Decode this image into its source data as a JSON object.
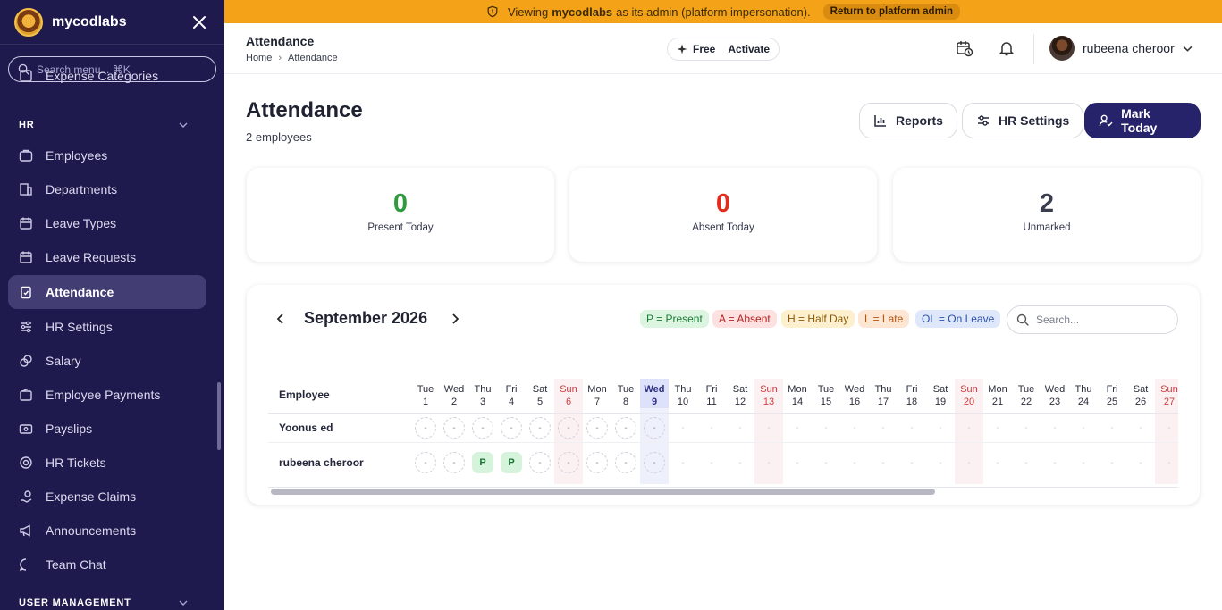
{
  "sidebar": {
    "brand": "mycodlabs",
    "search_placeholder": "Search menu... ⌘K",
    "partial_item": "Expense Categories",
    "hr_section": "HR",
    "items": [
      {
        "label": "Employees",
        "icon": "employees-icon"
      },
      {
        "label": "Departments",
        "icon": "building-icon"
      },
      {
        "label": "Leave Types",
        "icon": "calendar-icon"
      },
      {
        "label": "Leave Requests",
        "icon": "calendar-check-icon"
      },
      {
        "label": "Attendance",
        "icon": "clipboard-check-icon",
        "active": true
      },
      {
        "label": "HR Settings",
        "icon": "sliders-icon"
      },
      {
        "label": "Salary",
        "icon": "coins-icon"
      },
      {
        "label": "Employee Payments",
        "icon": "wallet-icon"
      },
      {
        "label": "Payslips",
        "icon": "receipt-icon"
      },
      {
        "label": "HR Tickets",
        "icon": "lifebuoy-icon"
      },
      {
        "label": "Expense Claims",
        "icon": "hand-coins-icon"
      },
      {
        "label": "Announcements",
        "icon": "megaphone-icon"
      },
      {
        "label": "Team Chat",
        "icon": "chat-icon"
      }
    ],
    "user_mgmt_section": "USER MANAGEMENT"
  },
  "banner": {
    "prefix": "Viewing",
    "org": "mycodlabs",
    "suffix": "as its admin (platform impersonation).",
    "return_label": "Return to platform admin",
    "color": "#f4a319"
  },
  "header": {
    "title": "Attendance",
    "breadcrumb": [
      "Home",
      "Attendance"
    ],
    "plan_label": "Free",
    "activate_label": "Activate",
    "user_name": "rubeena cheroor"
  },
  "main": {
    "title": "Attendance",
    "subtitle": "2 employees",
    "buttons": {
      "reports": "Reports",
      "hr_settings": "HR Settings",
      "mark_today": "Mark Today"
    }
  },
  "stats": [
    {
      "value": "0",
      "label": "Present Today",
      "color": "#2e9b3e"
    },
    {
      "value": "0",
      "label": "Absent Today",
      "color": "#e02d1e"
    },
    {
      "value": "2",
      "label": "Unmarked",
      "color": "#3a3d4d"
    }
  ],
  "calendar": {
    "month": "September 2026",
    "legend": [
      {
        "label": "P = Present",
        "bg": "#dcf5e1",
        "fg": "#1d7a36"
      },
      {
        "label": "A = Absent",
        "bg": "#fde0e0",
        "fg": "#b42121"
      },
      {
        "label": "H = Half Day",
        "bg": "#fdf0cf",
        "fg": "#8a5a05"
      },
      {
        "label": "L = Late",
        "bg": "#fde6d4",
        "fg": "#b6520f"
      },
      {
        "label": "OL = On Leave",
        "bg": "#dfe8fb",
        "fg": "#2a4fa6"
      }
    ],
    "search_placeholder": "Search...",
    "employee_header": "Employee",
    "days": [
      {
        "dow": "Tue",
        "d": "1"
      },
      {
        "dow": "Wed",
        "d": "2"
      },
      {
        "dow": "Thu",
        "d": "3"
      },
      {
        "dow": "Fri",
        "d": "4"
      },
      {
        "dow": "Sat",
        "d": "5"
      },
      {
        "dow": "Sun",
        "d": "6"
      },
      {
        "dow": "Mon",
        "d": "7"
      },
      {
        "dow": "Tue",
        "d": "8"
      },
      {
        "dow": "Wed",
        "d": "9"
      },
      {
        "dow": "Thu",
        "d": "10"
      },
      {
        "dow": "Fri",
        "d": "11"
      },
      {
        "dow": "Sat",
        "d": "12"
      },
      {
        "dow": "Sun",
        "d": "13"
      },
      {
        "dow": "Mon",
        "d": "14"
      },
      {
        "dow": "Tue",
        "d": "15"
      },
      {
        "dow": "Wed",
        "d": "16"
      },
      {
        "dow": "Thu",
        "d": "17"
      },
      {
        "dow": "Fri",
        "d": "18"
      },
      {
        "dow": "Sat",
        "d": "19"
      },
      {
        "dow": "Sun",
        "d": "20"
      },
      {
        "dow": "Mon",
        "d": "21"
      },
      {
        "dow": "Tue",
        "d": "22"
      },
      {
        "dow": "Wed",
        "d": "23"
      },
      {
        "dow": "Thu",
        "d": "24"
      },
      {
        "dow": "Fri",
        "d": "25"
      },
      {
        "dow": "Sat",
        "d": "26"
      },
      {
        "dow": "Sun",
        "d": "27"
      }
    ],
    "today_index": 8,
    "employees": [
      {
        "name": "Yoonus ed",
        "marks": [
          "-",
          "-",
          "-",
          "-",
          "-",
          "-",
          "-",
          "-",
          "-"
        ]
      },
      {
        "name": "rubeena cheroor",
        "marks": [
          "-",
          "-",
          "P",
          "P",
          "-",
          "-",
          "-",
          "-",
          "-"
        ]
      }
    ]
  }
}
